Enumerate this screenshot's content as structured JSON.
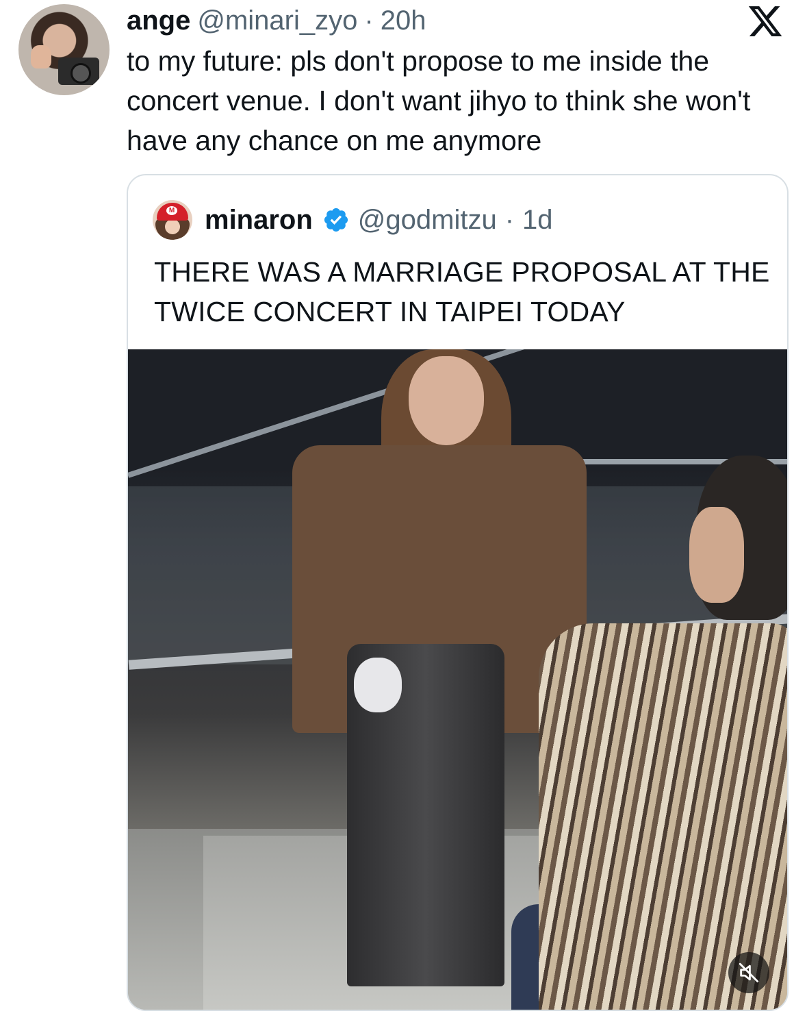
{
  "tweet": {
    "author_name": "ange",
    "author_handle": "@minari_zyo",
    "separator": "·",
    "time": "20h",
    "text": "to my future: pls don't propose to me inside the concert venue. I don't want jihyo to think she won't have any chance on me anymore",
    "platform_icon": "x-logo-icon"
  },
  "quoted": {
    "author_name": "minaron",
    "verified": true,
    "author_handle": "@godmitzu",
    "separator": "·",
    "time": "1d",
    "text": "THERE WAS A MARRIAGE PROPOSAL AT THE TWICE CONCERT IN TAIPEI TODAY",
    "media": {
      "type": "video",
      "muted": true,
      "control_icon": "muted-speaker-icon"
    }
  },
  "colors": {
    "text_primary": "#0f1419",
    "text_secondary": "#536471",
    "verified_blue": "#1d9bf0",
    "card_border": "#d8dfe4"
  }
}
